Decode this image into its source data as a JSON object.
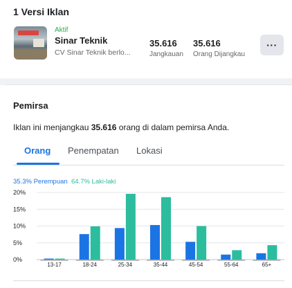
{
  "versions": {
    "title": "1 Versi Iklan",
    "ad": {
      "status": "Aktif",
      "name": "Sinar Teknik",
      "page": "CV Sinar Teknik berlo...",
      "reach_value": "35.616",
      "reach_label": "Jangkauan",
      "reached_value": "35.616",
      "reached_label": "Orang Dijangkau",
      "more_label": "···"
    }
  },
  "audience": {
    "title": "Pemirsa",
    "desc_prefix": "Iklan ini menjangkau ",
    "desc_value": "35.616",
    "desc_suffix": " orang di dalam pemirsa Anda.",
    "tabs": [
      "Orang",
      "Penempatan",
      "Lokasi"
    ],
    "active_tab": "Orang",
    "legend_female": "35.3% Perempuan",
    "legend_male": "64.7% Laki-laki"
  },
  "colors": {
    "female": "#1b74e4",
    "male": "#2bbd9e",
    "active_tab": "#1b74e4"
  },
  "chart_data": {
    "type": "bar",
    "categories": [
      "13-17",
      "18-24",
      "25-34",
      "35-44",
      "45-54",
      "55-64",
      "65+"
    ],
    "series": [
      {
        "name": "Perempuan",
        "values": [
          0.3,
          7.6,
          9.4,
          10.3,
          5.3,
          1.5,
          1.9
        ]
      },
      {
        "name": "Laki-laki",
        "values": [
          0.3,
          9.9,
          19.6,
          18.6,
          10.0,
          2.8,
          4.3
        ]
      }
    ],
    "yticks": [
      "20%",
      "15%",
      "10%",
      "5%",
      "0%"
    ],
    "ylim": [
      0,
      20
    ],
    "grid": true
  }
}
